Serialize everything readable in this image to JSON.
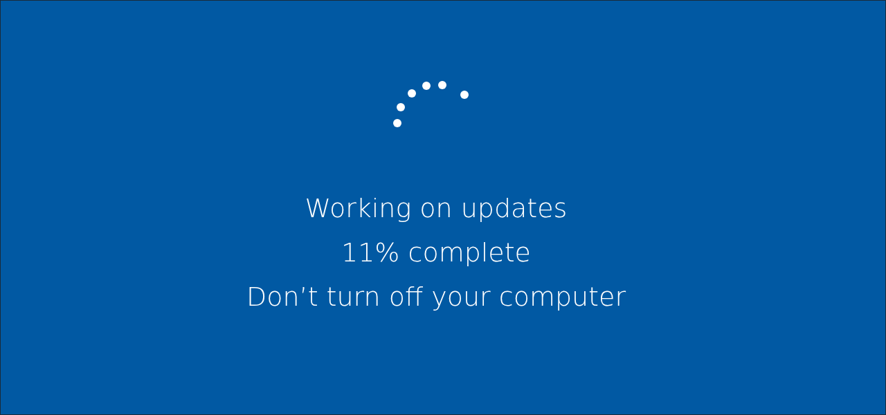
{
  "update_screen": {
    "messages": [
      "Working on updates",
      "11% complete",
      "Don’t turn off your computer"
    ]
  }
}
